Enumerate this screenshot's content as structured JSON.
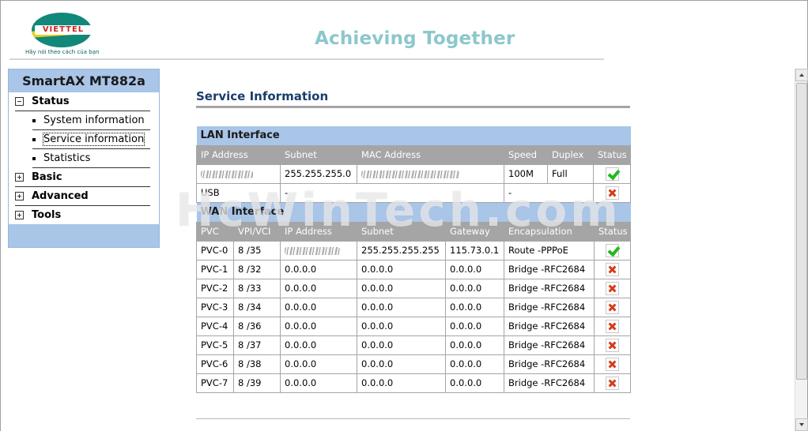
{
  "header": {
    "logo_text": "VIETTEL",
    "logo_tagline": "Hãy nói theo cách của bạn",
    "slogan": "Achieving Together"
  },
  "sidebar": {
    "title": "SmartAX MT882a",
    "groups": [
      {
        "label": "Status",
        "expanded": true,
        "items": [
          {
            "label": "System information"
          },
          {
            "label": "Service information",
            "current": true
          },
          {
            "label": "Statistics"
          }
        ]
      },
      {
        "label": "Basic",
        "expanded": false
      },
      {
        "label": "Advanced",
        "expanded": false
      },
      {
        "label": "Tools",
        "expanded": false
      }
    ]
  },
  "main": {
    "title": "Service Information",
    "lan": {
      "section_label": "LAN Interface",
      "columns": [
        "IP Address",
        "Subnet",
        "MAC Address",
        "Speed",
        "Duplex",
        "Status"
      ],
      "rows": [
        {
          "ip": "",
          "subnet": "255.255.255.0",
          "mac": "",
          "speed": "100M",
          "duplex": "Full",
          "status": "up"
        }
      ],
      "usb": {
        "name": "USB",
        "col2": "-",
        "col3": "-",
        "status": "down"
      }
    },
    "wan": {
      "section_label": "WAN Interface",
      "columns": [
        "PVC",
        "VPI/VCI",
        "IP Address",
        "Subnet",
        "Gateway",
        "Encapsulation",
        "Status"
      ],
      "rows": [
        {
          "pvc": "PVC-0",
          "vpivci": "8 /35",
          "ip": "",
          "subnet": "255.255.255.255",
          "gateway": "115.73.0.1",
          "encap": "Route -PPPoE",
          "status": "up"
        },
        {
          "pvc": "PVC-1",
          "vpivci": "8 /32",
          "ip": "0.0.0.0",
          "subnet": "0.0.0.0",
          "gateway": "0.0.0.0",
          "encap": "Bridge -RFC2684",
          "status": "down"
        },
        {
          "pvc": "PVC-2",
          "vpivci": "8 /33",
          "ip": "0.0.0.0",
          "subnet": "0.0.0.0",
          "gateway": "0.0.0.0",
          "encap": "Bridge -RFC2684",
          "status": "down"
        },
        {
          "pvc": "PVC-3",
          "vpivci": "8 /34",
          "ip": "0.0.0.0",
          "subnet": "0.0.0.0",
          "gateway": "0.0.0.0",
          "encap": "Bridge -RFC2684",
          "status": "down"
        },
        {
          "pvc": "PVC-4",
          "vpivci": "8 /36",
          "ip": "0.0.0.0",
          "subnet": "0.0.0.0",
          "gateway": "0.0.0.0",
          "encap": "Bridge -RFC2684",
          "status": "down"
        },
        {
          "pvc": "PVC-5",
          "vpivci": "8 /37",
          "ip": "0.0.0.0",
          "subnet": "0.0.0.0",
          "gateway": "0.0.0.0",
          "encap": "Bridge -RFC2684",
          "status": "down"
        },
        {
          "pvc": "PVC-6",
          "vpivci": "8 /38",
          "ip": "0.0.0.0",
          "subnet": "0.0.0.0",
          "gateway": "0.0.0.0",
          "encap": "Bridge -RFC2684",
          "status": "down"
        },
        {
          "pvc": "PVC-7",
          "vpivci": "8 /39",
          "ip": "0.0.0.0",
          "subnet": "0.0.0.0",
          "gateway": "0.0.0.0",
          "encap": "Bridge -RFC2684",
          "status": "down"
        }
      ]
    }
  },
  "watermark": "HcWinTech.com",
  "colors": {
    "section_bg": "#a9c5e8",
    "header_bg": "#a5a5a5",
    "title": "#1a3d6b",
    "ok": "#23b81e",
    "fail": "#d83a1a"
  },
  "icons": {
    "up": "check-icon",
    "down": "cross-icon"
  }
}
